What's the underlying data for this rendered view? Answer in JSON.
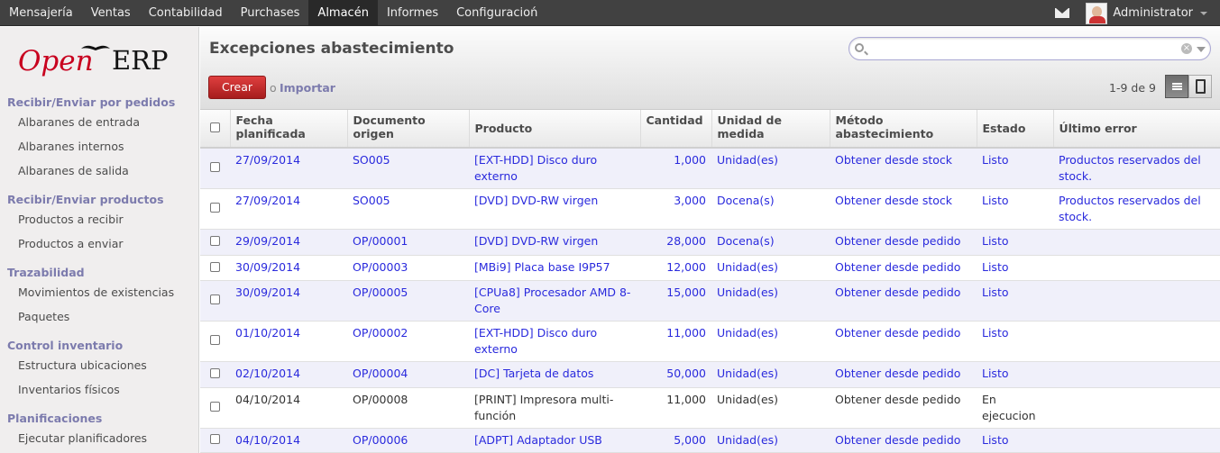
{
  "topmenu": [
    "Mensajería",
    "Ventas",
    "Contabilidad",
    "Purchases",
    "Almacén",
    "Informes",
    "Configuracioń"
  ],
  "user": {
    "name": "Administrator"
  },
  "logo": {
    "open": "Open",
    "erp": "ERP"
  },
  "sidebar": {
    "sections": [
      {
        "title": "Recibir/Enviar por pedidos",
        "items": [
          "Albaranes de entrada",
          "Albaranes internos",
          "Albaranes de salida"
        ]
      },
      {
        "title": "Recibir/Enviar productos",
        "items": [
          "Productos a recibir",
          "Productos a enviar"
        ]
      },
      {
        "title": "Trazabilidad",
        "items": [
          "Movimientos de existencias",
          "Paquetes"
        ]
      },
      {
        "title": "Control inventario",
        "items": [
          "Estructura ubicaciones",
          "Inventarios físicos"
        ]
      },
      {
        "title": "Planificaciones",
        "items": [
          "Ejecutar planificadores"
        ]
      }
    ]
  },
  "page": {
    "title": "Excepciones abastecimiento",
    "create_label": "Crear",
    "or_label": "o",
    "import_label": "Importar",
    "pager": "1-9 de 9",
    "search_value": ""
  },
  "table": {
    "headers": [
      "Fecha planificada",
      "Documento origen",
      "Producto",
      "Cantidad",
      "Unidad de medida",
      "Método abastecimiento",
      "Estado",
      "Último error"
    ],
    "rows": [
      [
        "27/09/2014",
        "SO005",
        "[EXT-HDD] Disco duro externo",
        "1,000",
        "Unidad(es)",
        "Obtener desde stock",
        "Listo",
        "Productos reservados del stock."
      ],
      [
        "27/09/2014",
        "SO005",
        "[DVD] DVD-RW virgen",
        "3,000",
        "Docena(s)",
        "Obtener desde stock",
        "Listo",
        "Productos reservados del stock."
      ],
      [
        "29/09/2014",
        "OP/00001",
        "[DVD] DVD-RW virgen",
        "28,000",
        "Docena(s)",
        "Obtener desde pedido",
        "Listo",
        ""
      ],
      [
        "30/09/2014",
        "OP/00003",
        "[MBi9] Placa base I9P57",
        "12,000",
        "Unidad(es)",
        "Obtener desde pedido",
        "Listo",
        ""
      ],
      [
        "30/09/2014",
        "OP/00005",
        "[CPUa8] Procesador AMD 8-Core",
        "15,000",
        "Unidad(es)",
        "Obtener desde pedido",
        "Listo",
        ""
      ],
      [
        "01/10/2014",
        "OP/00002",
        "[EXT-HDD] Disco duro externo",
        "11,000",
        "Unidad(es)",
        "Obtener desde pedido",
        "Listo",
        ""
      ],
      [
        "02/10/2014",
        "OP/00004",
        "[DC] Tarjeta de datos",
        "50,000",
        "Unidad(es)",
        "Obtener desde pedido",
        "Listo",
        ""
      ],
      [
        "04/10/2014",
        "OP/00008",
        "[PRINT] Impresora multi-función",
        "11,000",
        "Unidad(es)",
        "Obtener desde pedido",
        "En ejecucion",
        ""
      ],
      [
        "04/10/2014",
        "OP/00006",
        "[ADPT] Adaptador USB",
        "5,000",
        "Unidad(es)",
        "Obtener desde pedido",
        "Listo",
        ""
      ]
    ]
  },
  "colors": {
    "accent": "#7c7bad",
    "link": "#2a2add",
    "create": "#c02b2b",
    "topbar": "#414141"
  }
}
